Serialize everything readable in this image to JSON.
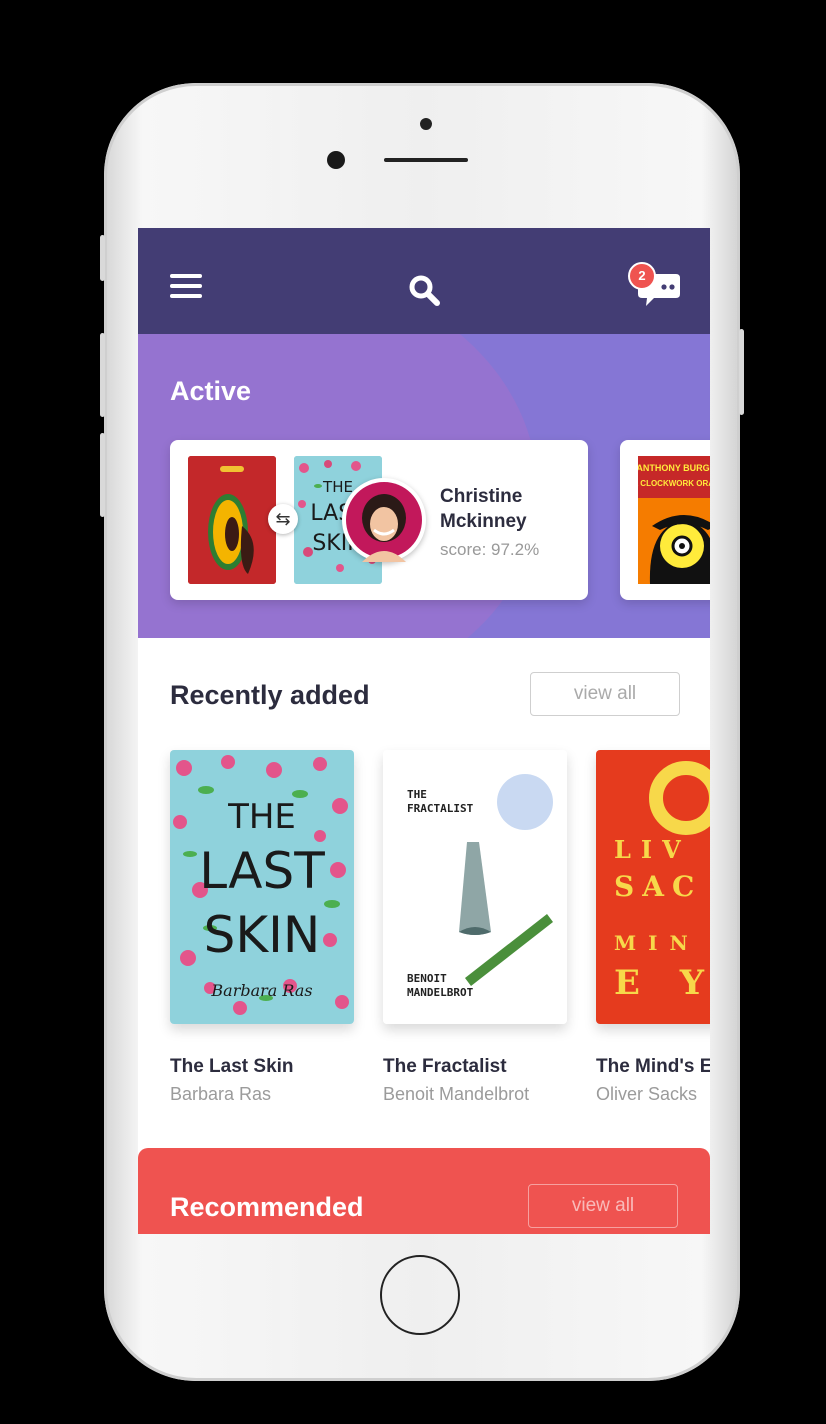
{
  "header": {
    "menu_icon": "hamburger-menu-icon",
    "search_icon": "search-icon",
    "chat_icon": "chat-bubble-icon",
    "notification_count": "2"
  },
  "active": {
    "title": "Active",
    "swap": {
      "book_a_cover": "papaya-book-cover",
      "book_b_cover": "the-last-skin-cover",
      "swap_icon": "swap-icon",
      "user_name": "Christine Mckinney",
      "score": "score: 97.2%"
    },
    "next_swap": {
      "cover_author": "ANTHONY BURGESS",
      "cover_title": "A CLOCKWORK ORANGE"
    }
  },
  "recently_added": {
    "title": "Recently added",
    "view_all": "view all",
    "books": [
      {
        "title": "The Last Skin",
        "author": "Barbara Ras",
        "cover_text": [
          "THE",
          "LAST",
          "SKIN"
        ],
        "cover_author": "Barbara Ras",
        "cover_color": "#8fd2dc"
      },
      {
        "title": "The Fractalist",
        "author": "Benoit Mandelbrot",
        "cover_text": [
          "THE",
          "FRACTALIST"
        ],
        "cover_author": [
          "BENOIT",
          "MANDELBROT"
        ],
        "cover_color": "#ffffff"
      },
      {
        "title": "The Mind's E",
        "author": "Oliver Sacks",
        "cover_text": [
          "LIV",
          "SAC",
          "MIN",
          "E Y"
        ],
        "cover_color": "#e53b1e"
      }
    ]
  },
  "recommended": {
    "title": "Recommended",
    "view_all": "view all",
    "color": "#ef5350"
  },
  "colors": {
    "topbar": "#433d74",
    "active_bg": "#8576d5",
    "accent_red": "#ef5350"
  }
}
